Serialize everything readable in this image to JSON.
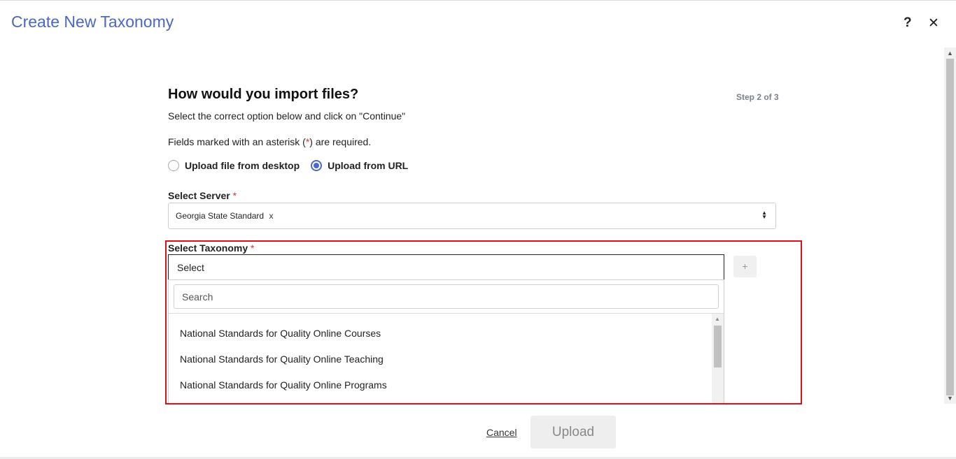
{
  "header": {
    "title": "Create New Taxonomy",
    "help_label": "?",
    "close_label": "✕"
  },
  "form": {
    "title": "How would you import files?",
    "step": "Step 2 of 3",
    "subtitle": "Select the correct option below and click on \"Continue\"",
    "required_note_prefix": "Fields marked with an asterisk (",
    "required_note_asterisk": "*",
    "required_note_suffix": ") are required.",
    "upload_options": [
      {
        "label": "Upload file from desktop",
        "selected": false
      },
      {
        "label": "Upload from URL",
        "selected": true
      }
    ],
    "server": {
      "label": "Select Server",
      "required_mark": "*",
      "selected_value": "Georgia State Standard",
      "remove_label": "x"
    },
    "taxonomy": {
      "label": "Select Taxonomy",
      "required_mark": "*",
      "selected_text": "Select",
      "add_label": "+",
      "search_placeholder": "Search",
      "options": [
        "National Standards for Quality Online Courses",
        "National Standards for Quality Online Teaching",
        "National Standards for Quality Online Programs"
      ]
    }
  },
  "footer": {
    "cancel_label": "Cancel",
    "upload_label": "Upload"
  },
  "colors": {
    "accent": "#4a68c8",
    "required": "#d33333",
    "highlight": "#e0101a"
  }
}
